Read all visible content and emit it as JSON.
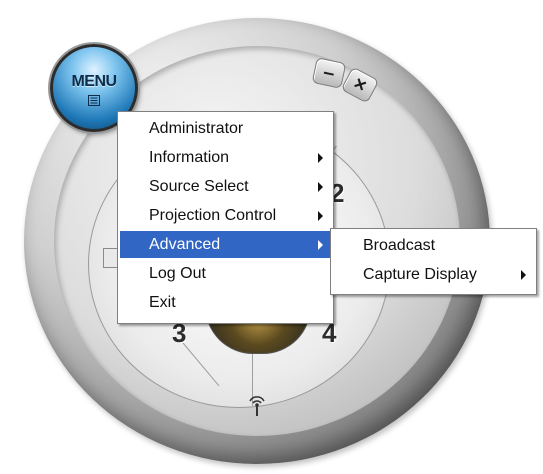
{
  "menu_orb": {
    "label": "MENU",
    "icon": "menu-doc-icon"
  },
  "window_controls": {
    "minimize_label": "–",
    "close_label": "×"
  },
  "dial": {
    "zones": [
      "2",
      "3",
      "4"
    ],
    "bottom_icon": "antenna-icon"
  },
  "main_menu": {
    "items": [
      {
        "label": "Administrator",
        "has_submenu": false
      },
      {
        "label": "Information",
        "has_submenu": true
      },
      {
        "label": "Source Select",
        "has_submenu": true
      },
      {
        "label": "Projection Control",
        "has_submenu": true
      },
      {
        "label": "Advanced",
        "has_submenu": true,
        "highlighted": true
      },
      {
        "label": "Log Out",
        "has_submenu": false
      },
      {
        "label": "Exit",
        "has_submenu": false
      }
    ]
  },
  "sub_menu": {
    "items": [
      {
        "label": "Broadcast",
        "has_submenu": false
      },
      {
        "label": "Capture Display",
        "has_submenu": true
      }
    ]
  },
  "colors": {
    "highlight": "#3166c4",
    "menu_bg": "#ffffff",
    "orb_blue": "#1f79b8"
  }
}
